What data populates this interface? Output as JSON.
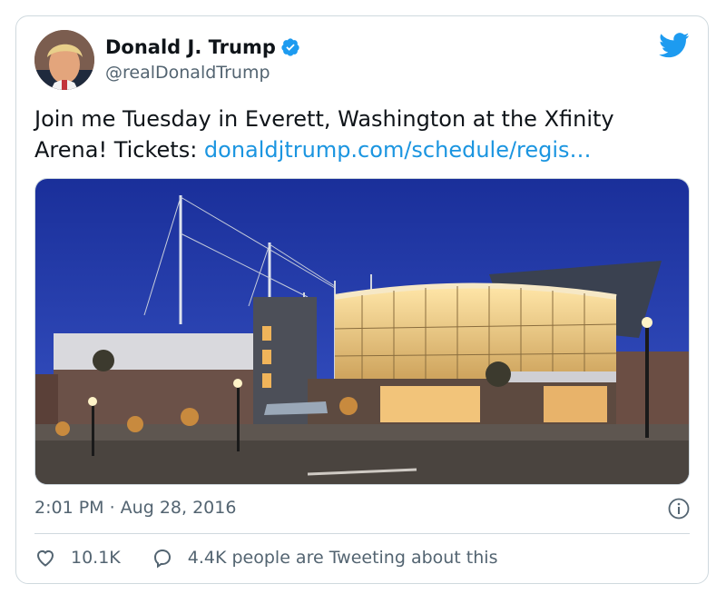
{
  "tweet": {
    "author_name": "Donald J. Trump",
    "author_handle": "@realDonaldTrump",
    "text_before": "Join me Tuesday in Everett, Washington at the Xfinity Arena! Tickets: ",
    "link_text": "donaldjtrump.com/schedule/regis…",
    "image_alt": "Xfinity Arena at dusk",
    "timestamp": "2:01 PM · Aug 28, 2016",
    "likes": "10.1K",
    "tweeting_text": "4.4K people are Tweeting about this"
  },
  "icons": {
    "avatar": "avatar",
    "verified": "verified-badge-icon",
    "brand": "twitter-bird-icon",
    "info": "info-icon",
    "like": "heart-icon",
    "reply": "speech-bubble-icon"
  },
  "colors": {
    "brand": "#1d9bf0",
    "link": "#1b95e0",
    "text": "#0f1419",
    "secondary": "#536471",
    "border": "#cfd9de"
  }
}
